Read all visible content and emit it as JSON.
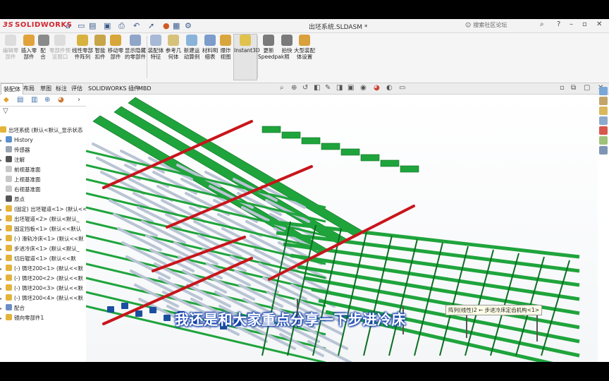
{
  "titlebar": {
    "app_name": "SOLIDWORKS",
    "app_prefix": "3S",
    "document_title": "出坯系统.SLDASM *",
    "search_placeholder": "搜索社区论坛"
  },
  "ribbon": {
    "buttons": [
      {
        "label": "编辑零\n部件",
        "disabled": true,
        "icon": "edit-component-icon",
        "color": "#b8b8b8"
      },
      {
        "label": "插入零\n部件",
        "disabled": false,
        "icon": "insert-component-icon",
        "color": "#e2a23b"
      },
      {
        "label": "配\n合",
        "disabled": false,
        "icon": "mate-icon",
        "color": "#8a8a8a"
      },
      {
        "label": "零部件预\n览窗口",
        "disabled": true,
        "icon": "component-preview-icon",
        "color": "#b8b8b8"
      },
      {
        "label": "线性零部\n件阵列",
        "disabled": false,
        "icon": "linear-pattern-icon",
        "color": "#d8b23e"
      },
      {
        "label": "智能\n扣件",
        "disabled": false,
        "icon": "smart-fasteners-icon",
        "color": "#c9a54a"
      },
      {
        "label": "移动零\n部件",
        "disabled": false,
        "icon": "move-component-icon",
        "color": "#d8a63a"
      },
      {
        "label": "显示隐藏\n的零部件",
        "disabled": false,
        "icon": "show-hidden-icon",
        "color": "#8fa6c9"
      },
      {
        "label": "装配体\n特征",
        "disabled": false,
        "icon": "assembly-features-icon",
        "color": "#a7b9d6"
      },
      {
        "label": "参考几\n何体",
        "disabled": false,
        "icon": "reference-geometry-icon",
        "color": "#d6c27a"
      },
      {
        "label": "新建运\n动算例",
        "disabled": false,
        "icon": "new-motion-study-icon",
        "color": "#8ab3d9"
      },
      {
        "label": "材料明\n细表",
        "disabled": false,
        "icon": "bom-icon",
        "color": "#7c9ccb"
      },
      {
        "label": "爆炸\n视图",
        "disabled": false,
        "icon": "exploded-view-icon",
        "color": "#d9a63e"
      },
      {
        "label": "Instant3D",
        "disabled": false,
        "icon": "instant3d-icon",
        "color": "#e0c24c"
      },
      {
        "label": "更新\nSpeedpak",
        "disabled": false,
        "icon": "speedpak-icon",
        "color": "#7a7a7a"
      },
      {
        "label": "拍快\n照",
        "disabled": false,
        "icon": "snapshot-icon",
        "color": "#7a7a7a"
      },
      {
        "label": "大型装配\n体设置",
        "disabled": false,
        "icon": "large-assembly-icon",
        "color": "#d9a03c"
      }
    ]
  },
  "tabs": [
    {
      "label": "装配体",
      "active": true
    },
    {
      "label": "布局",
      "active": false
    },
    {
      "label": "草图",
      "active": false
    },
    {
      "label": "标注",
      "active": false
    },
    {
      "label": "评估",
      "active": false
    },
    {
      "label": "SOLIDWORKS 插件",
      "active": false
    },
    {
      "label": "MBD",
      "active": false
    }
  ],
  "tree": {
    "root": "出坯系统 (默认<默认_显示状态",
    "items": [
      {
        "label": "History",
        "icon": "history-icon",
        "color": "#5a8fd0",
        "expand": true
      },
      {
        "label": "传感器",
        "icon": "sensor-icon",
        "color": "#9aa5b2",
        "expand": false
      },
      {
        "label": "注解",
        "icon": "annotation-icon",
        "color": "#555555",
        "expand": true
      },
      {
        "label": "前视基准面",
        "icon": "plane-icon",
        "color": "#c8c8c8",
        "expand": false
      },
      {
        "label": "上视基准面",
        "icon": "plane-icon",
        "color": "#c8c8c8",
        "expand": false
      },
      {
        "label": "右视基准面",
        "icon": "plane-icon",
        "color": "#c8c8c8",
        "expand": false
      },
      {
        "label": "原点",
        "icon": "origin-icon",
        "color": "#555555",
        "expand": false
      },
      {
        "label": "(固定) 出坯辊道<1> (默认<<",
        "icon": "subassembly-icon",
        "color": "#e3b33a",
        "expand": true
      },
      {
        "label": "出坯辊道<2> (默认<默认_",
        "icon": "subassembly-icon",
        "color": "#e3b33a",
        "expand": true
      },
      {
        "label": "固定挡板<1> (默认<<默认",
        "icon": "part-icon",
        "color": "#e3b33a",
        "expand": true
      },
      {
        "label": "(-) 滑轨冷床<1> (默认<<默",
        "icon": "subassembly-icon",
        "color": "#e3b33a",
        "expand": true
      },
      {
        "label": "步进冷床<1> (默认<默认_",
        "icon": "subassembly-icon",
        "color": "#e3b33a",
        "expand": true
      },
      {
        "label": "切后辊道<1> (默认<<默",
        "icon": "warning-icon",
        "color": "#e3b33a",
        "expand": true
      },
      {
        "label": "(-) 铸坯200<1> (默认<<默",
        "icon": "part-icon",
        "color": "#e3b33a",
        "expand": true
      },
      {
        "label": "(-) 铸坯200<2> (默认<<默",
        "icon": "part-icon",
        "color": "#e3b33a",
        "expand": true
      },
      {
        "label": "(-) 铸坯200<3> (默认<<默",
        "icon": "part-icon",
        "color": "#e3b33a",
        "expand": true
      },
      {
        "label": "(-) 铸坯200<4> (默认<<默",
        "icon": "part-icon",
        "color": "#e3b33a",
        "expand": true
      },
      {
        "label": "配合",
        "icon": "mates-folder-icon",
        "color": "#6a8fc6",
        "expand": true
      },
      {
        "label": "镜向零部件1",
        "icon": "mirror-component-icon",
        "color": "#e3b33a",
        "expand": true
      }
    ]
  },
  "viewport": {
    "subtitle": "我还是和大家重点分享一下步进冷床",
    "tooltip": "阵列(线性)2 ← 步进冷床定齿机构<1>",
    "colors": {
      "frame_green": "#1fa43c",
      "frame_dark": "#0c6e22",
      "red_bar": "#c8151b",
      "roller": "#b9c4d4",
      "motor_blue": "#1a4fa0"
    }
  }
}
